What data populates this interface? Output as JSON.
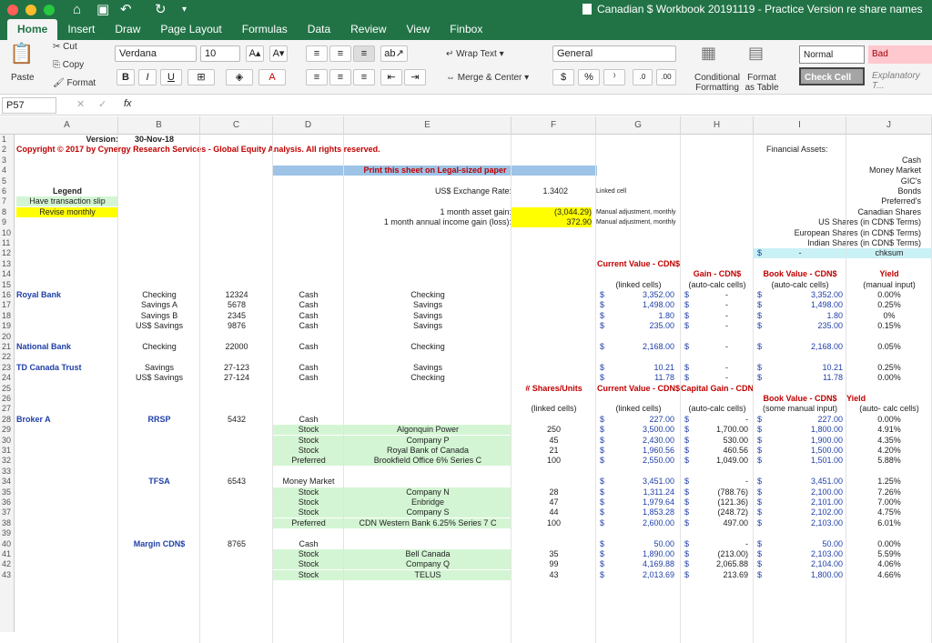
{
  "window": {
    "title": "Canadian $ Workbook 20191119 - Practice Version re share names"
  },
  "tabs": [
    "Home",
    "Insert",
    "Draw",
    "Page Layout",
    "Formulas",
    "Data",
    "Review",
    "View",
    "Finbox"
  ],
  "ribbon": {
    "cut": "Cut",
    "copy": "Copy",
    "format": "Format",
    "paste": "Paste",
    "font": "Verdana",
    "size": "10",
    "wrap": "Wrap Text",
    "merge": "Merge & Center",
    "number_format": "General",
    "conditional": "Conditional Formatting",
    "format_table": "Format as Table",
    "styles": {
      "normal": "Normal",
      "bad": "Bad",
      "check": "Check Cell",
      "explanatory": "Explanatory T..."
    }
  },
  "formula_bar": {
    "cell": "P57",
    "fx": "fx"
  },
  "columns": [
    "A",
    "B",
    "C",
    "D",
    "E",
    "F",
    "G",
    "H",
    "I",
    "J"
  ],
  "header_block": {
    "version_label": "Version:",
    "version_date": "30-Nov-18",
    "copyright": "Copyright © 2017 by Cynergy Research Services - Global Equity Analysis. All rights reserved.",
    "print_note": "Print this sheet on Legal-sized paper",
    "fx_label": "US$ Exchange Rate:",
    "fx_value": "1.3402",
    "fx_note": "Linked cell",
    "asset_gain_label": "1 month asset gain:",
    "asset_gain": "(3,044.29)",
    "income_gain_label": "1 month annual income gain (loss):",
    "income_gain": "372.90",
    "manual_note": "Manual adjustment, monthly",
    "legend": "Legend",
    "legend_1": "Have transaction slip",
    "legend_2": "Revise monthly",
    "fin_assets": "Financial Assets:",
    "fin_list": [
      "Cash",
      "Money Market",
      "GIC's",
      "Bonds",
      "Preferred's",
      "Canadian Shares",
      "US Shares (in CDN$ Terms)",
      "European Shares (in CDN$ Terms)",
      "Indian Shares (in CDN$ Terms)"
    ],
    "chksum": "chksum",
    "dollar": "$",
    "dash": "-"
  },
  "bank_headers": {
    "current_value": "Current Value - CDN$",
    "cv_sub": "(linked cells)",
    "gain": "Gain - CDN$",
    "gain_sub": "(auto-calc cells)",
    "book": "Book Value - CDN$",
    "book_sub": "(auto-calc cells)",
    "yield": "Yield",
    "yield_sub": "(manual input)"
  },
  "bank_rows": [
    {
      "r": "16",
      "a": "Royal Bank",
      "b": "Checking",
      "c": "12324",
      "d": "Cash",
      "e": "Checking",
      "g": "3,352.00",
      "i": "3,352.00",
      "j": "0.00%"
    },
    {
      "r": "17",
      "a": "",
      "b": "Savings A",
      "c": "5678",
      "d": "Cash",
      "e": "Savings",
      "g": "1,498.00",
      "i": "1,498.00",
      "j": "0.25%"
    },
    {
      "r": "18",
      "a": "",
      "b": "Savings B",
      "c": "2345",
      "d": "Cash",
      "e": "Savings",
      "g": "1.80",
      "i": "1.80",
      "j": "0%"
    },
    {
      "r": "19",
      "a": "",
      "b": "US$ Savings",
      "c": "9876",
      "d": "Cash",
      "e": "Savings",
      "g": "235.00",
      "i": "235.00",
      "j": "0.15%"
    },
    {
      "r": "21",
      "a": "National Bank",
      "b": "Checking",
      "c": "22000",
      "d": "Cash",
      "e": "Checking",
      "g": "2,168.00",
      "i": "2,168.00",
      "j": "0.05%"
    },
    {
      "r": "23",
      "a": "TD Canada Trust",
      "b": "Savings",
      "c": "27-123",
      "d": "Cash",
      "e": "Savings",
      "g": "10.21",
      "i": "10.21",
      "j": "0.25%"
    },
    {
      "r": "24",
      "a": "",
      "b": "US$ Savings",
      "c": "27-124",
      "d": "Cash",
      "e": "Checking",
      "g": "11.78",
      "i": "11.78",
      "j": "0.00%"
    }
  ],
  "broker_headers": {
    "shares": "# Shares/Units",
    "shares_sub": "(linked cells)",
    "current_value": "Current Value - CDN$",
    "cv_sub": "(linked cells)",
    "cap_gain": "Capital Gain - CDN$",
    "cg_sub": "(auto-calc cells)",
    "book": "Book Value - CDN$",
    "book_sub": "(some manual input)",
    "yield": "Yield",
    "yield_sub": "(auto- calc cells)"
  },
  "broker_rows": [
    {
      "r": "28",
      "a": "Broker A",
      "b": "RRSP",
      "c": "5432",
      "d": "Cash",
      "e": "",
      "f": "",
      "g": "227.00",
      "h": "-",
      "i": "227.00",
      "j": "0.00%"
    },
    {
      "r": "29",
      "a": "",
      "b": "",
      "c": "",
      "d": "Stock",
      "e": "Algonquin Power",
      "f": "250",
      "g": "3,500.00",
      "h": "1,700.00",
      "i": "1,800.00",
      "j": "4.91%"
    },
    {
      "r": "30",
      "a": "",
      "b": "",
      "c": "",
      "d": "Stock",
      "e": "Company P",
      "f": "45",
      "g": "2,430.00",
      "h": "530.00",
      "i": "1,900.00",
      "j": "4.35%"
    },
    {
      "r": "31",
      "a": "",
      "b": "",
      "c": "",
      "d": "Stock",
      "e": "Royal Bank of Canada",
      "f": "21",
      "g": "1,960.56",
      "h": "460.56",
      "i": "1,500.00",
      "j": "4.20%"
    },
    {
      "r": "32",
      "a": "",
      "b": "",
      "c": "",
      "d": "Preferred",
      "e": "Brookfield Office 6% Series C",
      "f": "100",
      "g": "2,550.00",
      "h": "1,049.00",
      "i": "1,501.00",
      "j": "5.88%"
    },
    {
      "r": "34",
      "a": "",
      "b": "TFSA",
      "c": "6543",
      "d": "Money Market",
      "e": "",
      "f": "",
      "g": "3,451.00",
      "h": "-",
      "i": "3,451.00",
      "j": "1.25%"
    },
    {
      "r": "35",
      "a": "",
      "b": "",
      "c": "",
      "d": "Stock",
      "e": "Company N",
      "f": "28",
      "g": "1,311.24",
      "h": "(788.76)",
      "i": "2,100.00",
      "j": "7.26%"
    },
    {
      "r": "36",
      "a": "",
      "b": "",
      "c": "",
      "d": "Stock",
      "e": "Enbridge",
      "f": "47",
      "g": "1,979.64",
      "h": "(121.36)",
      "i": "2,101.00",
      "j": "7.00%"
    },
    {
      "r": "37",
      "a": "",
      "b": "",
      "c": "",
      "d": "Stock",
      "e": "Company S",
      "f": "44",
      "g": "1,853.28",
      "h": "(248.72)",
      "i": "2,102.00",
      "j": "4.75%"
    },
    {
      "r": "38",
      "a": "",
      "b": "",
      "c": "",
      "d": "Preferred",
      "e": "CDN Western Bank 6.25% Series 7 C",
      "f": "100",
      "g": "2,600.00",
      "h": "497.00",
      "i": "2,103.00",
      "j": "6.01%"
    },
    {
      "r": "40",
      "a": "",
      "b": "Margin CDN$",
      "c": "8765",
      "d": "Cash",
      "e": "",
      "f": "",
      "g": "50.00",
      "h": "-",
      "i": "50.00",
      "j": "0.00%"
    },
    {
      "r": "41",
      "a": "",
      "b": "",
      "c": "",
      "d": "Stock",
      "e": "Bell Canada",
      "f": "35",
      "g": "1,890.00",
      "h": "(213.00)",
      "i": "2,103.00",
      "j": "5.59%"
    },
    {
      "r": "42",
      "a": "",
      "b": "",
      "c": "",
      "d": "Stock",
      "e": "Company Q",
      "f": "99",
      "g": "4,169.88",
      "h": "2,065.88",
      "i": "2,104.00",
      "j": "4.06%"
    },
    {
      "r": "43",
      "a": "",
      "b": "",
      "c": "",
      "d": "Stock",
      "e": "TELUS",
      "f": "43",
      "g": "2,013.69",
      "h": "213.69",
      "i": "1,800.00",
      "j": "4.66%"
    }
  ]
}
